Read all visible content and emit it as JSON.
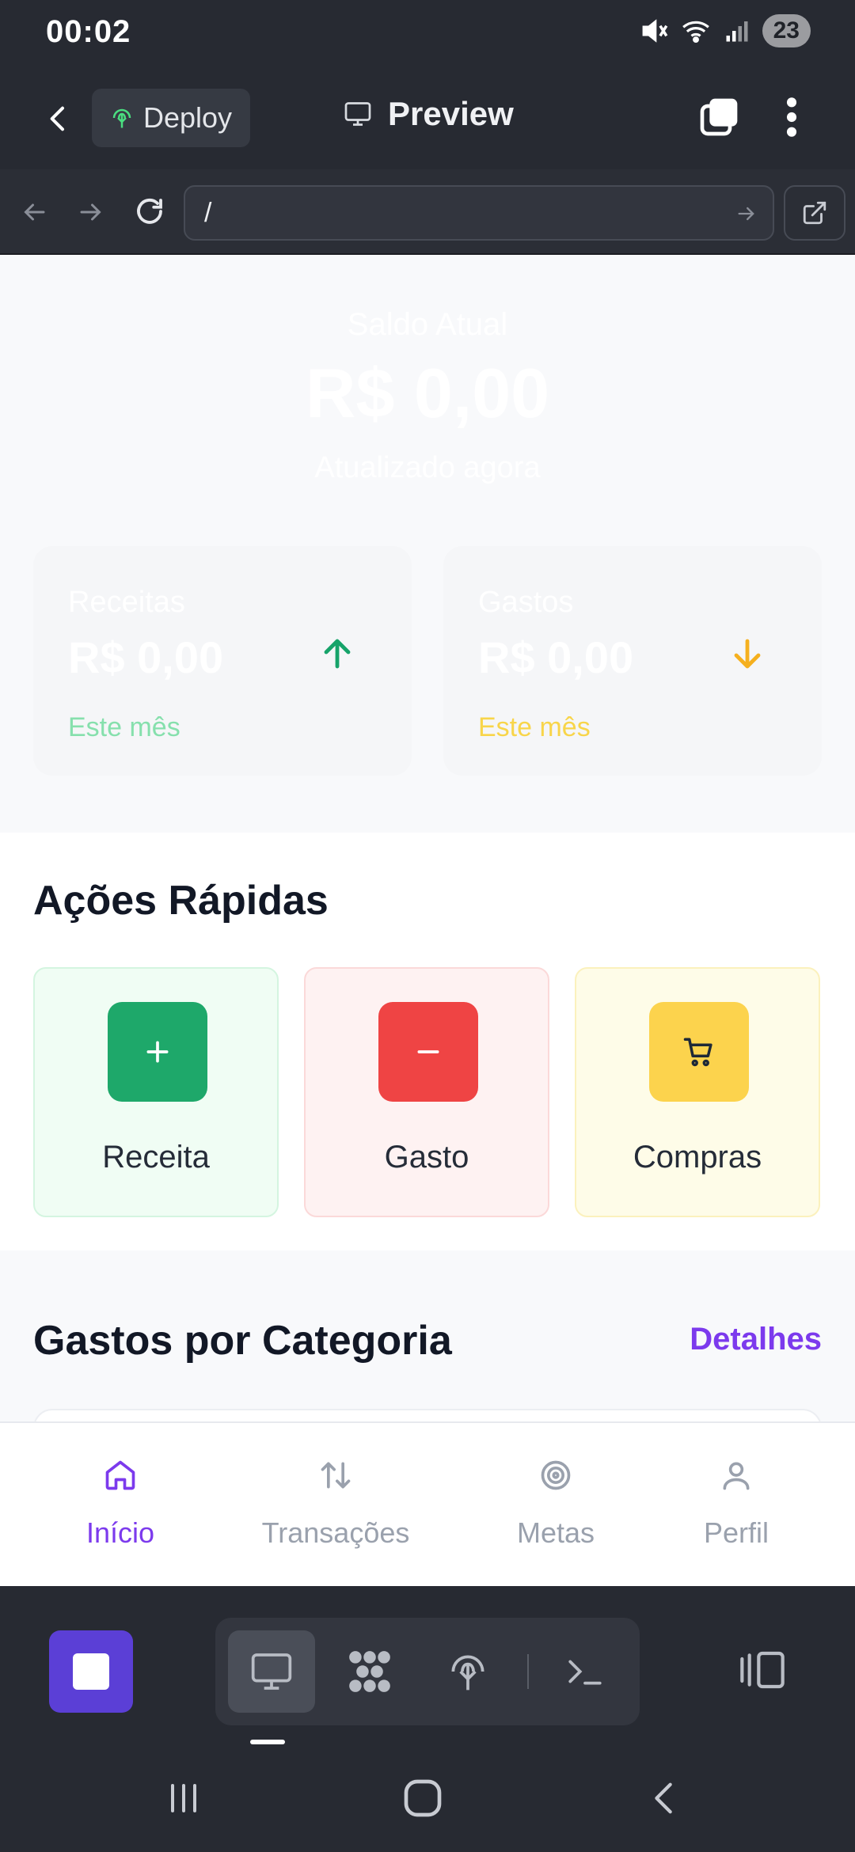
{
  "status_bar": {
    "time": "00:02",
    "battery": "23"
  },
  "app_bar": {
    "deploy_label": "Deploy",
    "preview_label": "Preview"
  },
  "url_bar": {
    "value": "/"
  },
  "balance": {
    "label": "Saldo Atual",
    "amount": "R$ 0,00",
    "updated": "Atualizado agora"
  },
  "summary_cards": [
    {
      "label": "Receitas",
      "amount": "R$ 0,00",
      "subtitle": "Este mês",
      "icon": "arrow-up-icon",
      "color": "#16a36a"
    },
    {
      "label": "Gastos",
      "amount": "R$ 0,00",
      "subtitle": "Este mês",
      "icon": "arrow-down-icon",
      "color": "#f5b01f"
    }
  ],
  "quick_actions": {
    "title": "Ações Rápidas",
    "items": [
      {
        "label": "Receita",
        "icon": "plus-icon",
        "color": "#1ea86a"
      },
      {
        "label": "Gasto",
        "icon": "minus-icon",
        "color": "#ef4444"
      },
      {
        "label": "Compras",
        "icon": "cart-icon",
        "color": "#fcd34d"
      }
    ]
  },
  "categories": {
    "title": "Gastos por Categoria",
    "details_link": "Detalhes"
  },
  "bottom_nav": {
    "items": [
      {
        "label": "Início",
        "icon": "home-icon",
        "active": true
      },
      {
        "label": "Transações",
        "icon": "transfer-arrows-icon",
        "active": false
      },
      {
        "label": "Metas",
        "icon": "target-icon",
        "active": false
      },
      {
        "label": "Perfil",
        "icon": "user-icon",
        "active": false
      }
    ]
  },
  "editor_toolbar": {
    "tools": [
      "monitor-icon",
      "grid-icon",
      "deploy-icon",
      "terminal-icon"
    ],
    "active_tool": "monitor-icon",
    "accent": "#5b3fd6"
  }
}
